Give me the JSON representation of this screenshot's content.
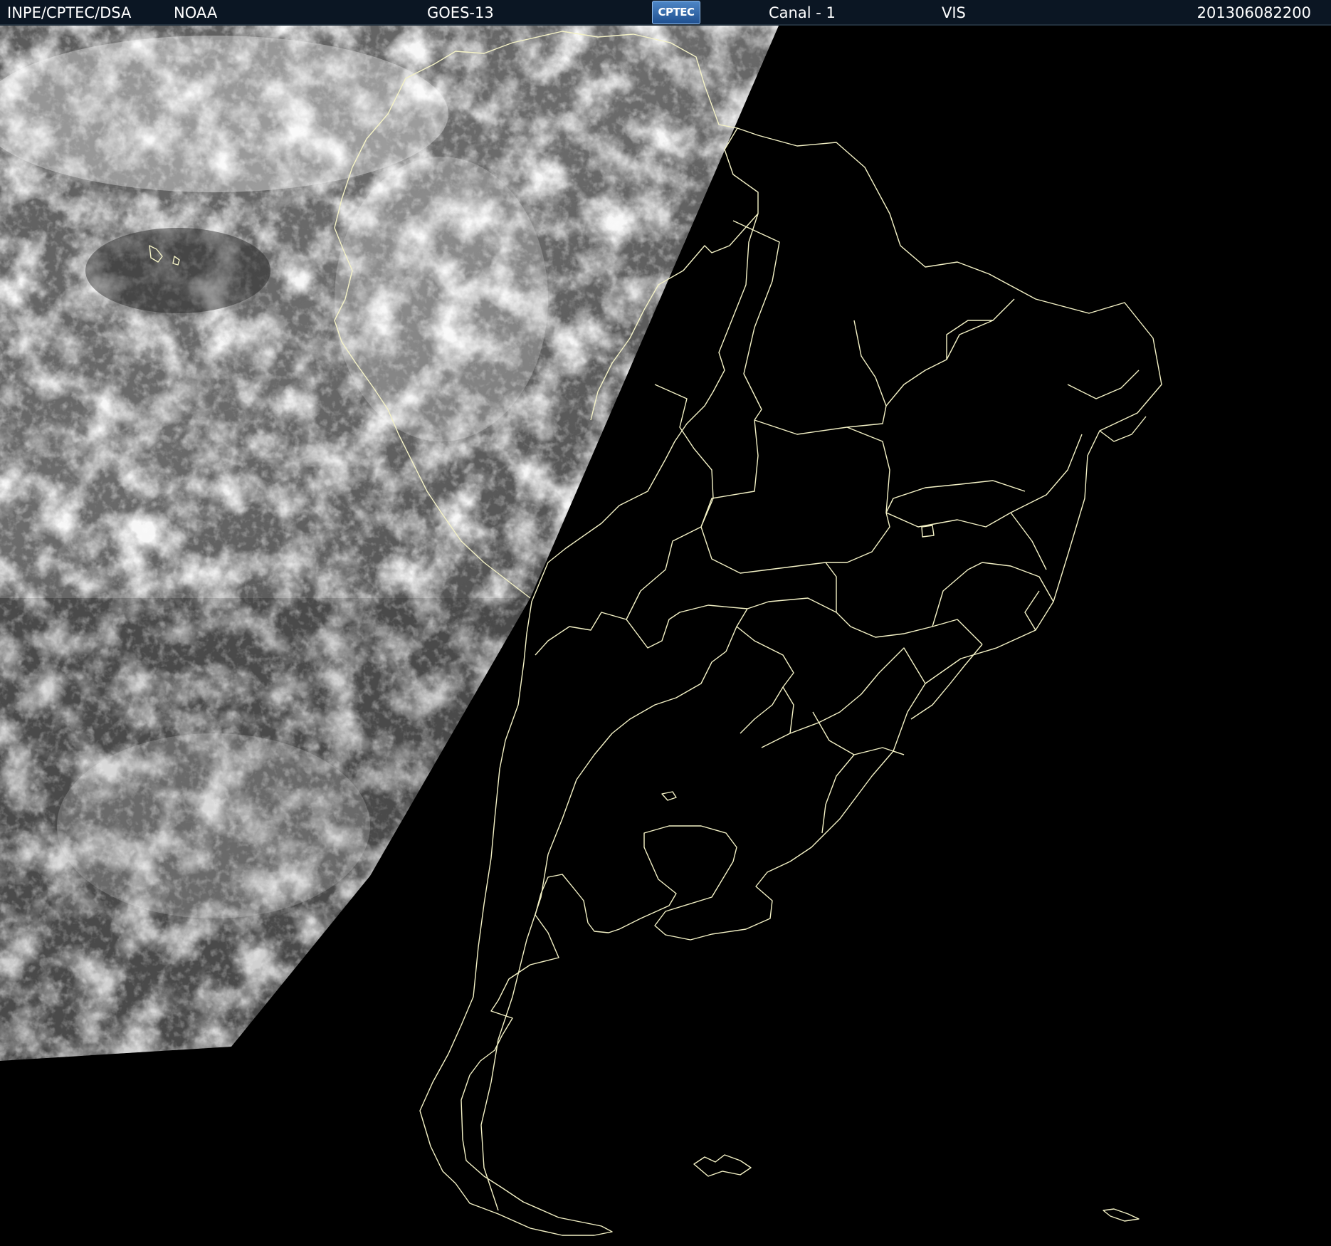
{
  "header": {
    "organization": "INPE/CPTEC/DSA",
    "agency": "NOAA",
    "satellite": "GOES-13",
    "logo_text": "CPTEC",
    "channel": "Canal - 1",
    "band": "VIS",
    "timestamp": "201306082200"
  },
  "colors": {
    "header_bg": "#0b1623",
    "header_text": "#ffffff",
    "border_lines": "#f4f2c6",
    "night_side": "#000000",
    "clouds": "#f2f2f2"
  },
  "icons": {
    "logo": "cptec-logo"
  }
}
